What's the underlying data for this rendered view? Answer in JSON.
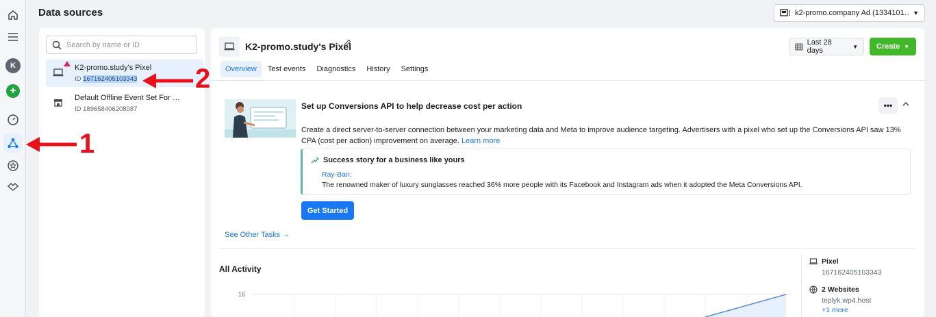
{
  "header": {
    "title": "Data sources",
    "account": "k2-promo.company Ad (1334101…"
  },
  "search": {
    "placeholder": "Search by name or ID"
  },
  "data_sources": [
    {
      "name": "K2-promo.study's Pixel",
      "id_prefix": "ID ",
      "id": "167162405103343",
      "warning": true
    },
    {
      "name": "Default Offline Event Set For …",
      "id_prefix": "ID ",
      "id": "189658406208087"
    }
  ],
  "pixel": {
    "title": "K2-promo.study's Pixel"
  },
  "toolbar": {
    "date_range": "Last 28 days",
    "create": "Create"
  },
  "tabs": [
    "Overview",
    "Test events",
    "Diagnostics",
    "History",
    "Settings"
  ],
  "capi_card": {
    "title": "Set up Conversions API to help decrease cost per action",
    "description": "Create a direct server-to-server connection between your marketing data and Meta to improve audience targeting. Advertisers with a pixel who set up the Conversions API saw 13% CPA (cost per action) improvement on average.",
    "learn_more": "Learn more",
    "more_label": "•••",
    "story_title": "Success story for a business like yours",
    "story_brand": "Ray-Ban:",
    "story_text": "The renowned maker of luxury sunglasses reached 36% more people with its Facebook and Instagram ads when it adopted the Meta Conversions API.",
    "cta": "Get Started"
  },
  "other_tasks": "See Other Tasks →",
  "activity": {
    "title": "All Activity",
    "y_tick": "16"
  },
  "side_info": {
    "pixel_label": "Pixel",
    "pixel_id": "167162405103343",
    "websites_label": "2 Websites",
    "website": "teplyk.wp4.host",
    "more": "+1 more"
  },
  "annotations": {
    "one": "1",
    "two": "2"
  },
  "colors": {
    "accent": "#1877f2",
    "create": "#42b72a",
    "annotation": "#e8101b",
    "warning": "#e0245e"
  }
}
